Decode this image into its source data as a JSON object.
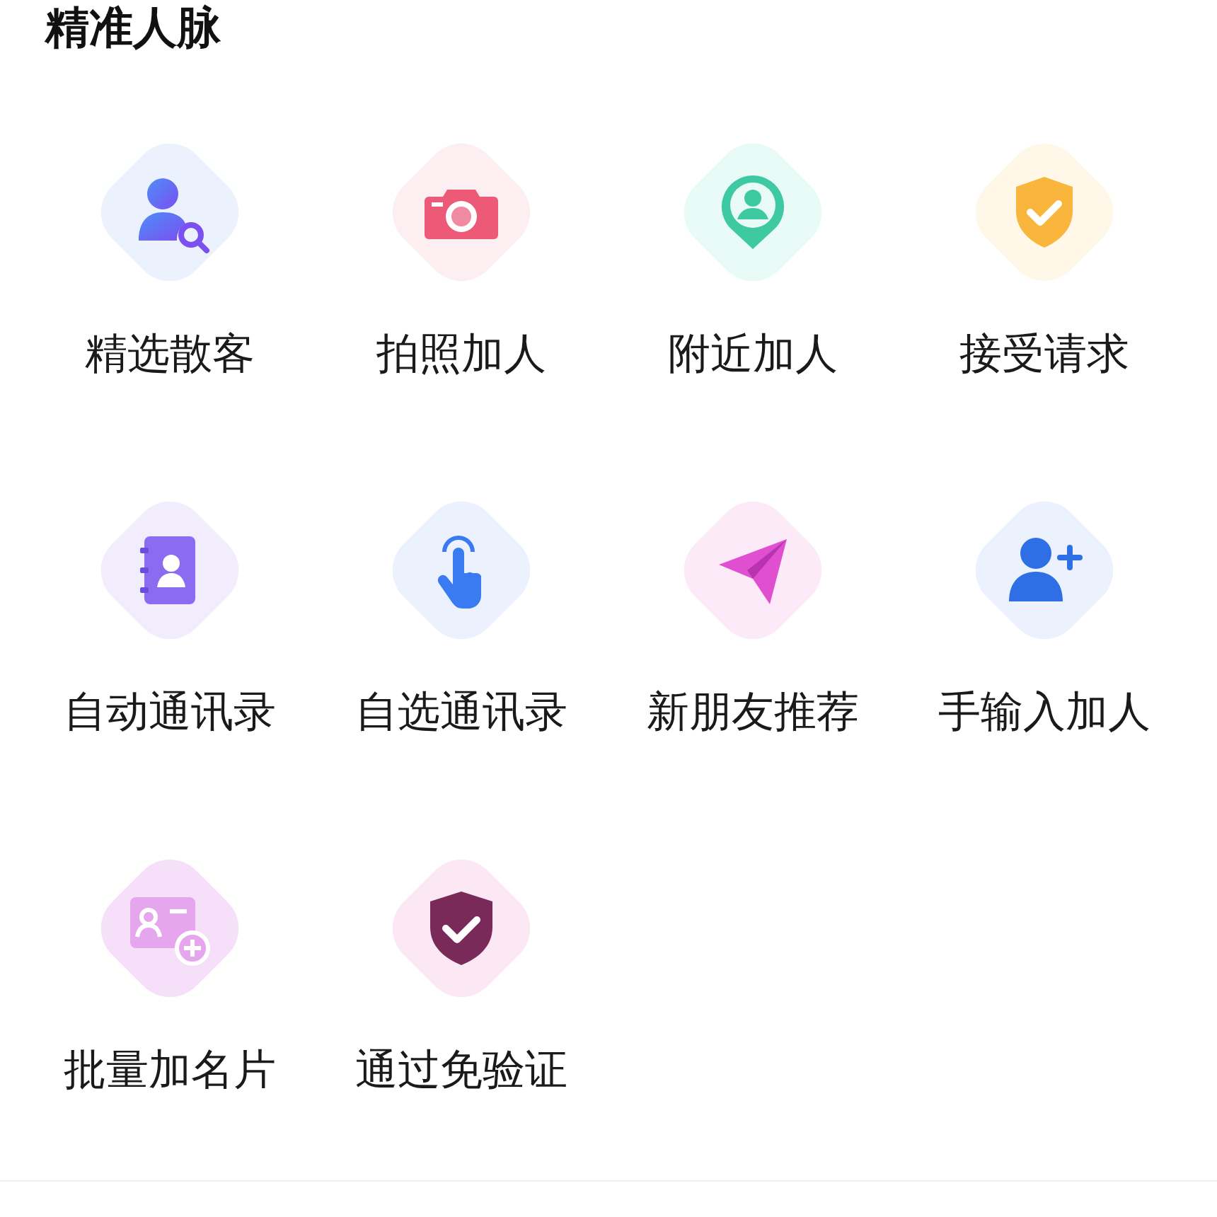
{
  "section_title": "精准人脉",
  "items": [
    {
      "kind": "person-search",
      "label": "精选散客"
    },
    {
      "kind": "camera",
      "label": "拍照加人"
    },
    {
      "kind": "location",
      "label": "附近加人"
    },
    {
      "kind": "shield",
      "label": "接受请求"
    },
    {
      "kind": "contacts",
      "label": "自动通讯录"
    },
    {
      "kind": "tap",
      "label": "自选通讯录"
    },
    {
      "kind": "plane",
      "label": "新朋友推荐"
    },
    {
      "kind": "person-add",
      "label": "手输入加人"
    },
    {
      "kind": "card-add",
      "label": "批量加名片"
    },
    {
      "kind": "shield-dark",
      "label": "通过免验证"
    }
  ]
}
